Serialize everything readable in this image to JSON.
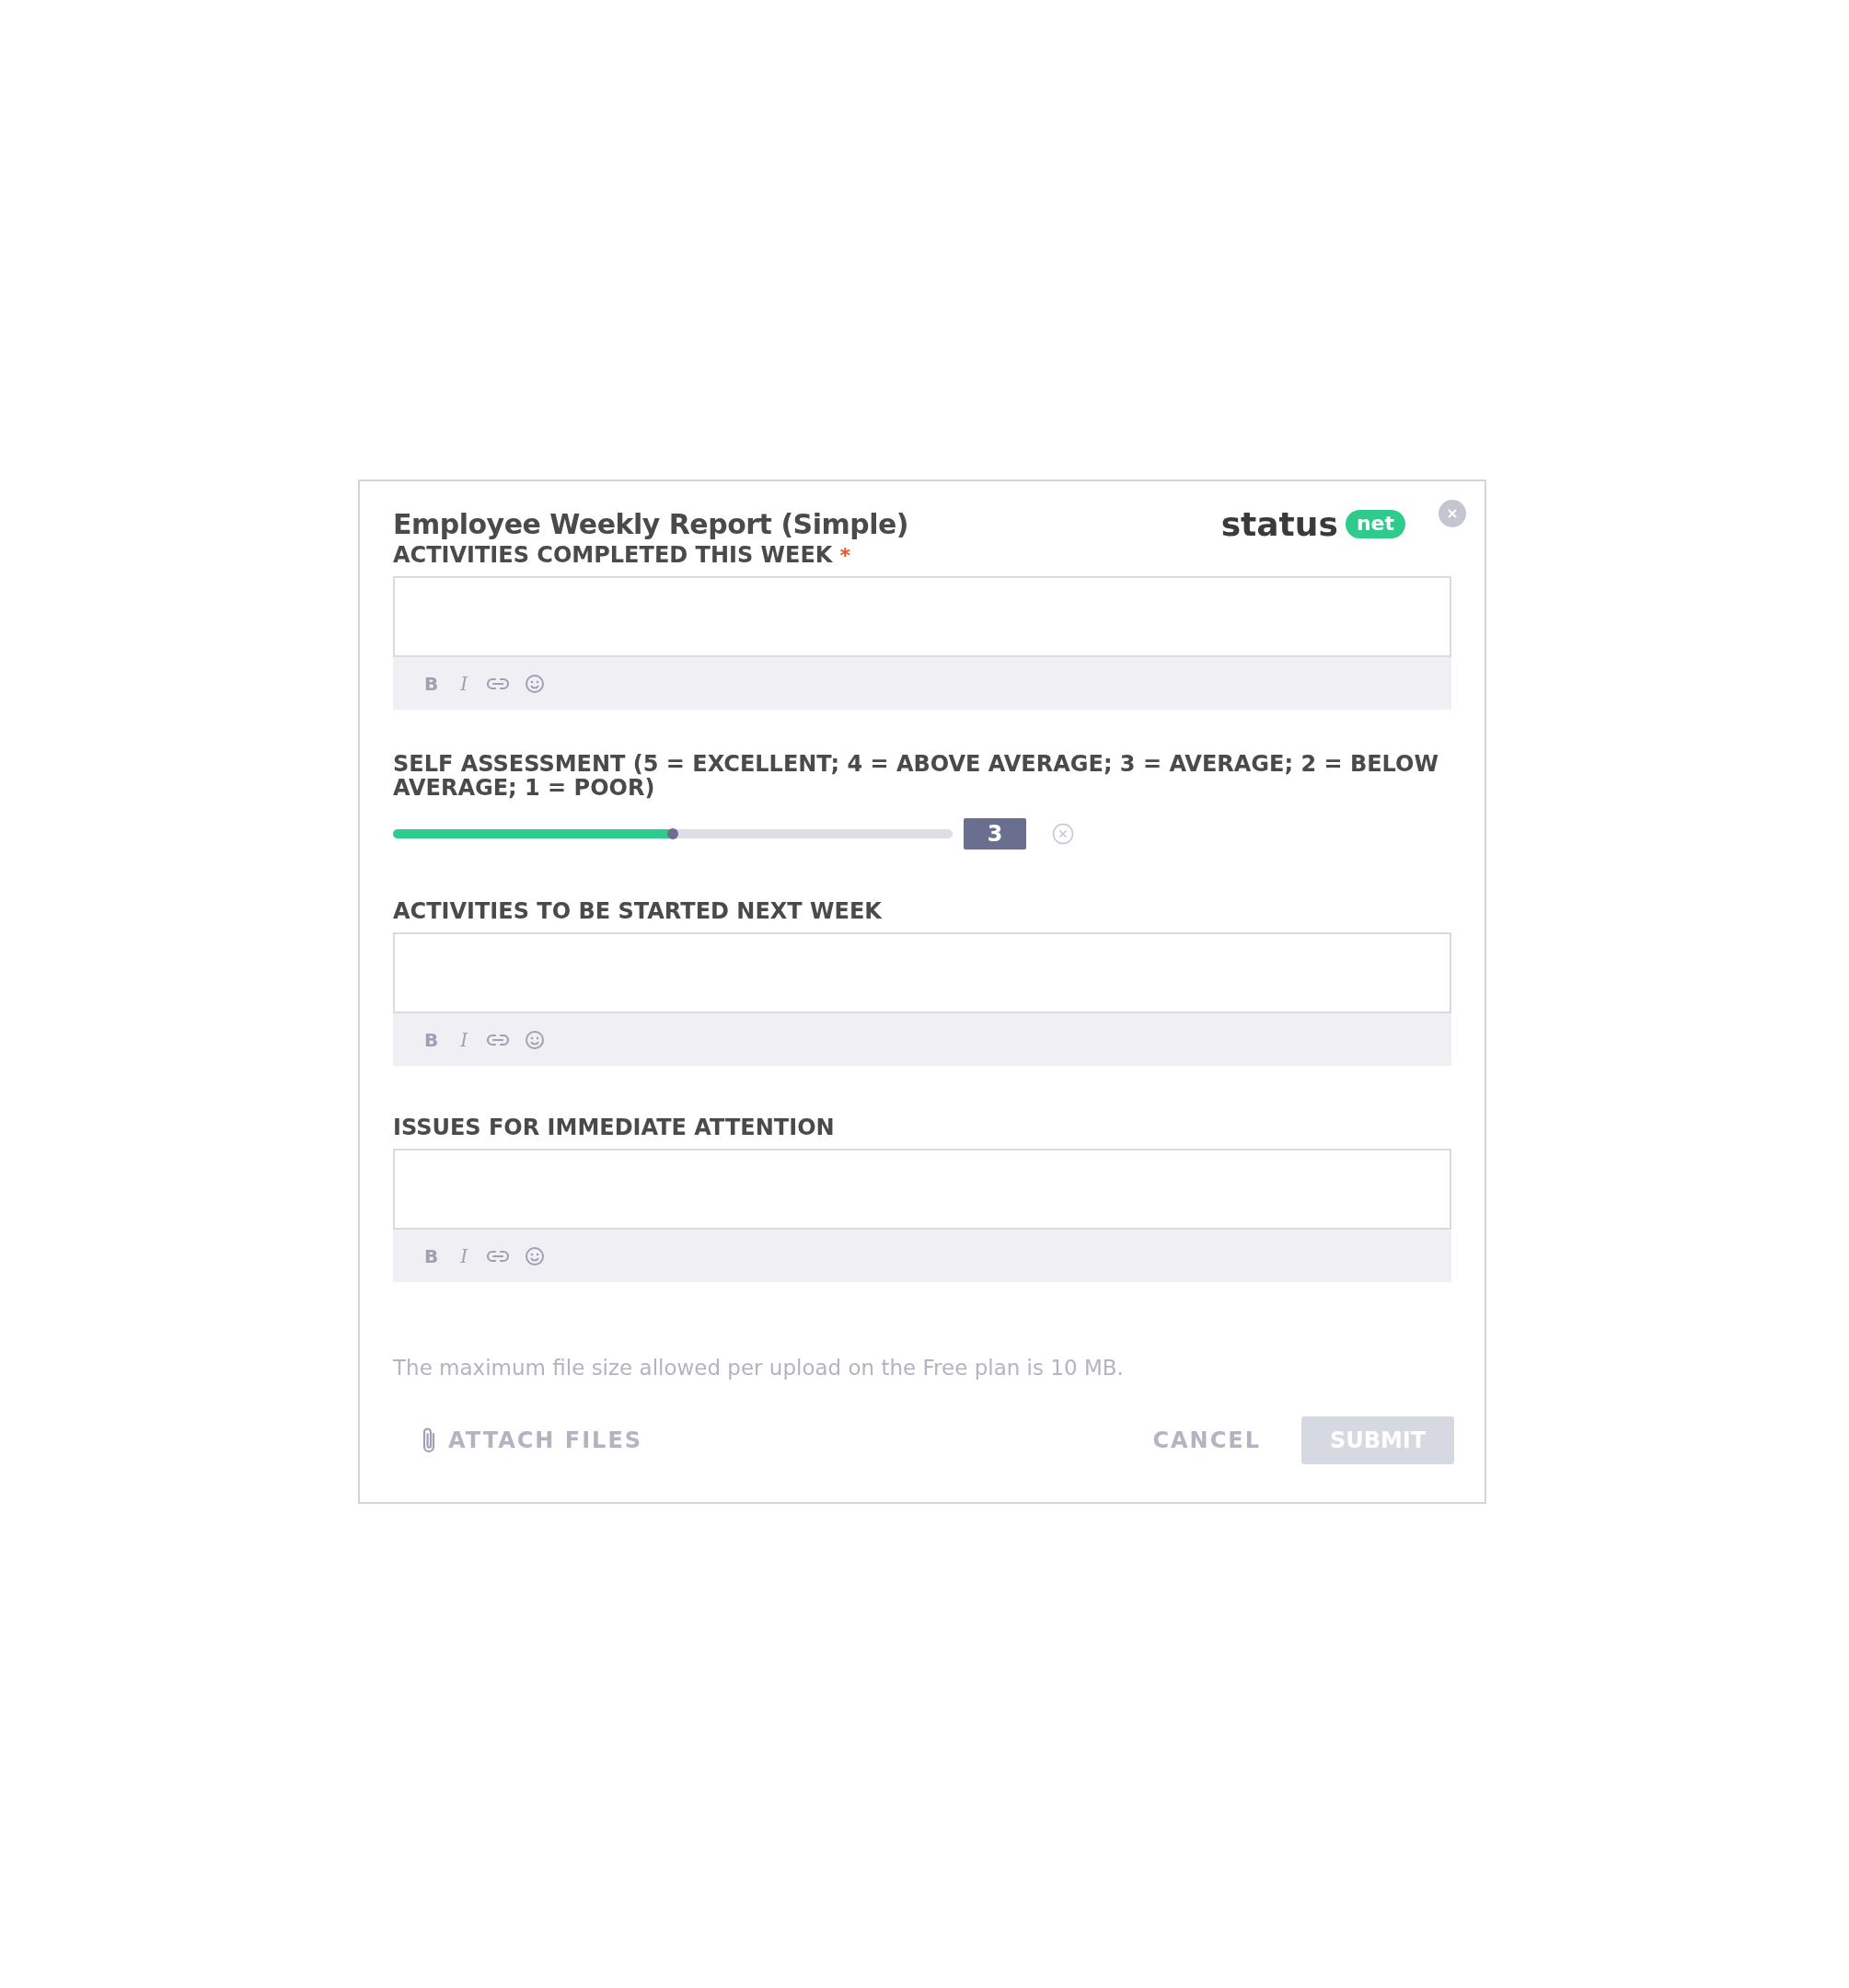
{
  "dialog": {
    "title": "Employee Weekly Report (Simple)",
    "logo": {
      "text": "status",
      "badge": "net"
    }
  },
  "sections": [
    {
      "kind": "editor",
      "label": "ACTIVITIES COMPLETED THIS WEEK",
      "required_mark": "*",
      "toolbar": [
        {
          "kind": "bold",
          "label": "B"
        },
        {
          "kind": "italic",
          "label": "I"
        },
        {
          "kind": "link"
        },
        {
          "kind": "emoji"
        }
      ]
    },
    {
      "kind": "slider",
      "label": "SELF ASSESSMENT (5 = EXCELLENT; 4 = ABOVE AVERAGE; 3 = AVERAGE; 2 = BELOW AVERAGE; 1 = POOR)",
      "level": 0.5,
      "value": "3"
    },
    {
      "kind": "editor",
      "label": "ACTIVITIES TO BE STARTED NEXT WEEK",
      "toolbar": [
        {
          "kind": "bold",
          "label": "B"
        },
        {
          "kind": "italic",
          "label": "I"
        },
        {
          "kind": "link"
        },
        {
          "kind": "emoji"
        }
      ]
    },
    {
      "kind": "editor",
      "label": "ISSUES FOR IMMEDIATE ATTENTION",
      "toolbar": [
        {
          "kind": "bold",
          "label": "B"
        },
        {
          "kind": "italic",
          "label": "I"
        },
        {
          "kind": "link"
        },
        {
          "kind": "emoji"
        }
      ]
    }
  ],
  "note": "The maximum file size allowed per upload on the Free plan is 10 MB.",
  "footer": {
    "attach": "ATTACH FILES",
    "cancel": "CANCEL",
    "submit": {
      "label": "SUBMIT",
      "disabled": true
    }
  }
}
